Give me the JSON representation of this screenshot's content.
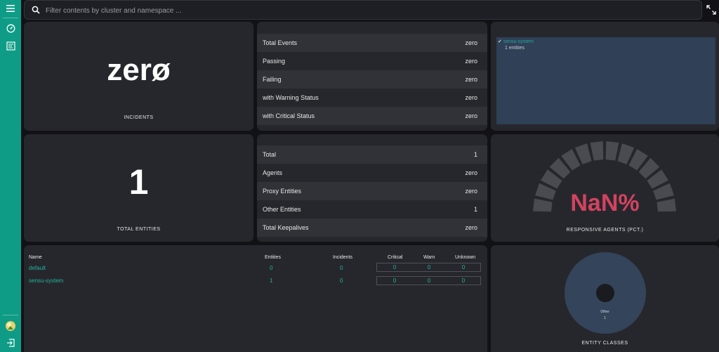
{
  "search": {
    "placeholder": "Filter contents by cluster and namespace ..."
  },
  "incidents": {
    "value": "zerø",
    "label": "INCIDENTS"
  },
  "event_stats": [
    {
      "label": "Total Events",
      "value": "zero"
    },
    {
      "label": "Passing",
      "value": "zero"
    },
    {
      "label": "Failing",
      "value": "zero"
    },
    {
      "label": "with Warning Status",
      "value": "zero"
    },
    {
      "label": "with Critical Status",
      "value": "zero"
    }
  ],
  "namespace_filter": {
    "name": "sensu-system",
    "count": "1 entities",
    "check": "✔"
  },
  "entities": {
    "value": "1",
    "label": "TOTAL ENTITIES"
  },
  "entity_stats": [
    {
      "label": "Total",
      "value": "1"
    },
    {
      "label": "Agents",
      "value": "zero"
    },
    {
      "label": "Proxy Entities",
      "value": "zero"
    },
    {
      "label": "Other Entities",
      "value": "1"
    },
    {
      "label": "Total Keepalives",
      "value": "zero"
    }
  ],
  "responsive": {
    "value": "NaN%",
    "label": "RESPONSIVE AGENTS (PCT.)",
    "filled_fraction": 0
  },
  "namespaces_table": {
    "headers": {
      "name": "Name",
      "entities": "Entities",
      "incidents": "Incidents",
      "critical": "Critical",
      "warn": "Warn",
      "unknown": "Unknown"
    },
    "rows": [
      {
        "name": "default",
        "entities": "0",
        "incidents": "0",
        "critical": "0",
        "warn": "0",
        "unknown": "0"
      },
      {
        "name": "sensu-system",
        "entities": "1",
        "incidents": "0",
        "critical": "0",
        "warn": "0",
        "unknown": "0"
      }
    ]
  },
  "entity_classes": {
    "label": "ENTITY CLASSES",
    "slice_name": "Other",
    "slice_value": "1"
  },
  "colors": {
    "accent": "#0e9c86",
    "teal_text": "#1fb49b",
    "nan_red": "#d2435f",
    "gauge_gray": "#4a4b51",
    "donut": "#34445a",
    "card": "#26272d"
  }
}
